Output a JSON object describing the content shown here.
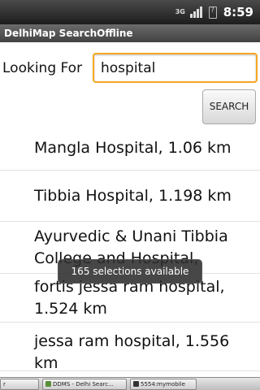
{
  "status_bar": {
    "network": "3G",
    "time": "8:59",
    "battery_icon": "battery-unknown-icon",
    "signal_icon": "signal-icon"
  },
  "app": {
    "title": "DelhiMap SearchOffline"
  },
  "search": {
    "label": "Looking For",
    "value": "hospital",
    "button_label": "SEARCH",
    "accent_color": "#f6a623"
  },
  "results": [
    {
      "text": "Mangla Hospital,  1.06 km"
    },
    {
      "text": "Tibbia Hospital,  1.198 km"
    },
    {
      "text": "Ayurvedic & Unani Tibbia College and Hospital,"
    },
    {
      "text": "fortis jessa ram hospital, 1.524 km"
    },
    {
      "text": "jessa ram hospital,  1.556 km"
    }
  ],
  "toast": {
    "text": "165 selections available"
  },
  "taskbar": {
    "items": [
      {
        "label": "r"
      },
      {
        "label": "DDMS - Delhi Searc..."
      },
      {
        "label": "5554:mymobile"
      }
    ]
  }
}
